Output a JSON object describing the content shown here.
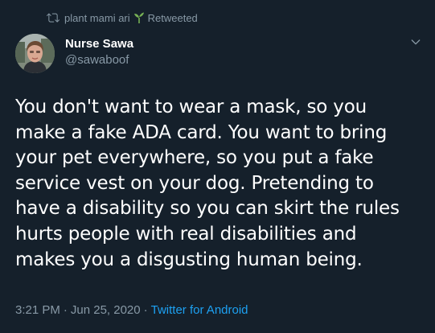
{
  "retweet_bar": {
    "retweeter": "plant mami ari",
    "emoji_icon": "seedling-icon",
    "label": "Retweeted"
  },
  "author": {
    "display_name": "Nurse Sawa",
    "handle": "@sawaboof"
  },
  "tweet": {
    "text": "You don't want to wear a mask, so you make a fake ADA card. You want to bring your pet everywhere, so you put a fake service vest on your dog. Pretending to have a disability so you can skirt the rules hurts people with real disabilities and makes you a disgusting human being.",
    "lines": [
      "You don't want to wear a mask, so you",
      "make a fake ADA card. You want to bring",
      "your pet everywhere, so you put a fake",
      "service vest on your dog. Pretending to",
      "have a disability so you can skirt the rules",
      "hurts people with real disabilities and",
      "makes you a disgusting human being."
    ]
  },
  "meta": {
    "time": "3:21 PM",
    "separator": "·",
    "date": "Jun 25, 2020",
    "source": "Twitter for Android"
  },
  "colors": {
    "background": "#15202b",
    "text": "#ffffff",
    "secondary": "#8899a6",
    "link": "#1da1f2",
    "emoji_green": "#77b255"
  }
}
